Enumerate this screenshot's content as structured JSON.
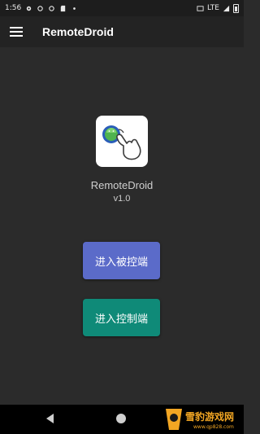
{
  "status_bar": {
    "time": "1:56",
    "network": "LTE"
  },
  "app_bar": {
    "title": "RemoteDroid",
    "menu_icon": "hamburger-menu-icon"
  },
  "main": {
    "logo_icon": "remotedroid-logo-icon",
    "app_name": "RemoteDroid",
    "version": "v1.0",
    "buttons": {
      "passive_label": "进入被控端",
      "control_label": "进入控制端"
    }
  },
  "colors": {
    "passive_button": "#5b6bc9",
    "control_button": "#0f8a78",
    "background": "#2b2b2b"
  },
  "nav_bar": {
    "back_icon": "back-triangle-icon",
    "home_icon": "home-circle-icon"
  },
  "watermark": {
    "text": "雪豹游戏网",
    "sub": "www.qp828.com"
  }
}
